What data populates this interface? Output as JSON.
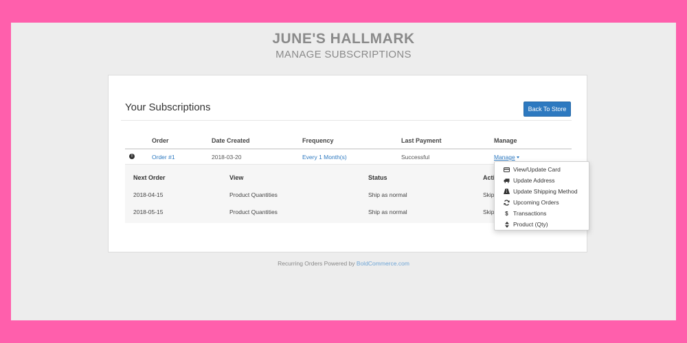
{
  "header": {
    "store_name": "JUNE'S HALLMARK",
    "page_title": "MANAGE SUBSCRIPTIONS"
  },
  "panel": {
    "title": "Your Subscriptions",
    "back_button": "Back To Store"
  },
  "table": {
    "columns": [
      "Order",
      "Date Created",
      "Frequency",
      "Last Payment",
      "Manage"
    ],
    "row": {
      "order": "Order #1",
      "date_created": "2018-03-20",
      "frequency": "Every 1 Month(s)",
      "last_payment": "Successful",
      "manage": "Manage"
    }
  },
  "upcoming": {
    "columns": [
      "Next Order",
      "View",
      "Status",
      "Acti"
    ],
    "rows": [
      {
        "next_order": "2018-04-15",
        "view": "Product Quantities",
        "status": "Ship as normal",
        "action": "Skip"
      },
      {
        "next_order": "2018-05-15",
        "view": "Product Quantities",
        "status": "Ship as normal",
        "action": "Skip"
      }
    ]
  },
  "manage_menu": {
    "items": [
      {
        "label": "View/Update Card",
        "icon": "credit-card-icon"
      },
      {
        "label": "Update Address",
        "icon": "truck-icon"
      },
      {
        "label": "Update Shipping Method",
        "icon": "road-icon"
      },
      {
        "label": "Upcoming Orders",
        "icon": "refresh-icon"
      },
      {
        "label": "Transactions",
        "icon": "dollar-icon"
      },
      {
        "label": "Product (Qty)",
        "icon": "sort-icon"
      }
    ]
  },
  "footer": {
    "text": "Recurring Orders Powered by",
    "link": "BoldCommerce.com"
  },
  "colors": {
    "frame": "#ff5fac",
    "page_bg": "#ededed",
    "accent": "#2d79c0"
  }
}
